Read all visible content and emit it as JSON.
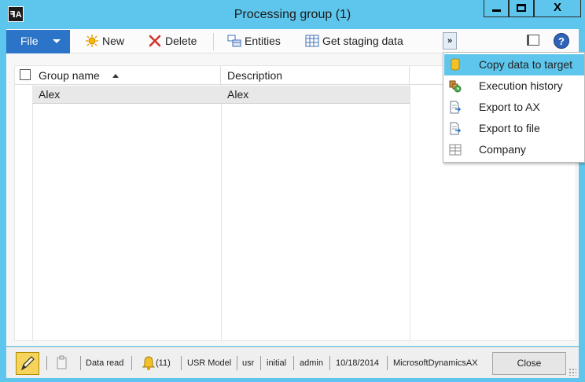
{
  "window": {
    "title": "Processing group (1)",
    "app_icon_text": "ꟻA",
    "close_glyph": "X"
  },
  "toolbar": {
    "file_label": "File",
    "new_label": "New",
    "delete_label": "Delete",
    "entities_label": "Entities",
    "staging_label": "Get staging data",
    "overflow_glyph": "»",
    "help_glyph": "?"
  },
  "grid": {
    "columns": [
      "Group name",
      "Description"
    ],
    "sort_column": "Group name",
    "rows": [
      {
        "group_name": "Alex",
        "description": "Alex"
      }
    ]
  },
  "menu": {
    "items": [
      {
        "label": "Copy data to target",
        "icon": "database-copy-icon",
        "active": true
      },
      {
        "label": "Execution history",
        "icon": "history-icon",
        "active": false
      },
      {
        "label": "Export to AX",
        "icon": "export-document-icon",
        "active": false
      },
      {
        "label": "Export to file",
        "icon": "export-file-icon",
        "active": false
      },
      {
        "label": "Company",
        "icon": "company-grid-icon",
        "active": false
      }
    ]
  },
  "statusbar": {
    "status": "Data read",
    "notifications": "(11)",
    "model": "USR Model",
    "layer": "usr",
    "state": "initial",
    "user": "admin",
    "date": "10/18/2014",
    "server": "MicrosoftDynamicsAX",
    "close_label": "Close"
  },
  "colors": {
    "frame": "#5ec6ec",
    "file_button": "#2b74c7",
    "menu_highlight": "#5ec6ec",
    "edit_mode": "#f6d35a"
  }
}
